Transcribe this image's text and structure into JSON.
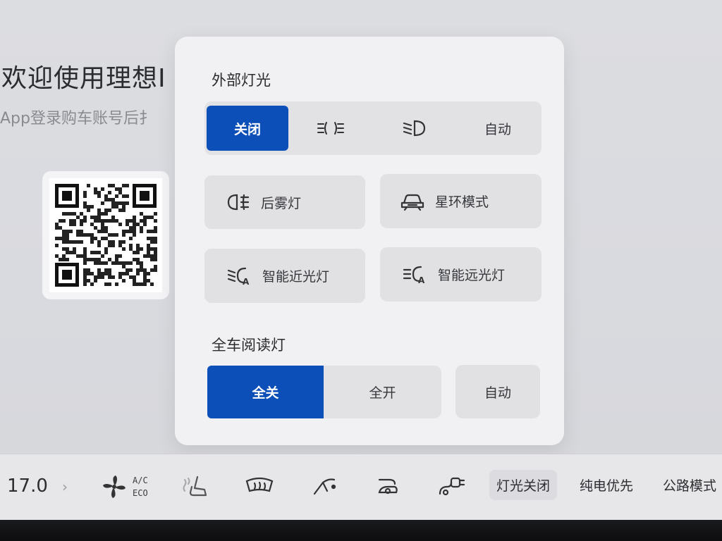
{
  "background": {
    "welcome_title": "欢迎使用理想I",
    "welcome_subtitle": "App登录购车账号后扌"
  },
  "panel": {
    "exterior_section_title": "外部灯光",
    "exterior_modes": [
      {
        "label": "关闭",
        "icon": "",
        "active": true
      },
      {
        "label": "",
        "icon": "side-marker-lights-icon",
        "active": false
      },
      {
        "label": "",
        "icon": "low-beam-icon",
        "active": false
      },
      {
        "label": "自动",
        "icon": "",
        "active": false
      }
    ],
    "tiles": [
      {
        "label": "后雾灯",
        "icon": "rear-fog-light-icon"
      },
      {
        "label": "星环模式",
        "icon": "star-ring-car-icon"
      },
      {
        "label": "智能近光灯",
        "icon": "smart-low-beam-icon"
      },
      {
        "label": "智能远光灯",
        "icon": "smart-high-beam-icon"
      }
    ],
    "reading_section_title": "全车阅读灯",
    "reading_modes": [
      {
        "label": "全关",
        "active": true
      },
      {
        "label": "全开",
        "active": false
      }
    ],
    "reading_auto_label": "自动"
  },
  "bottombar": {
    "temperature": "17.0",
    "chevron": "›",
    "ac_label": "A/C",
    "eco_label": "ECO",
    "icons": [
      "fan-icon",
      "seat-heat-icon",
      "defrost-icon",
      "mirror-icon",
      "door-icon",
      "charge-plug-icon"
    ],
    "lights_off_label": "灯光关闭",
    "ev_priority_label": "纯电优先",
    "road_mode_label": "公路模式"
  },
  "colors": {
    "accent": "#0d4fb8",
    "panel_bg": "#f1f1f3",
    "tile_bg": "#e1e1e4"
  }
}
